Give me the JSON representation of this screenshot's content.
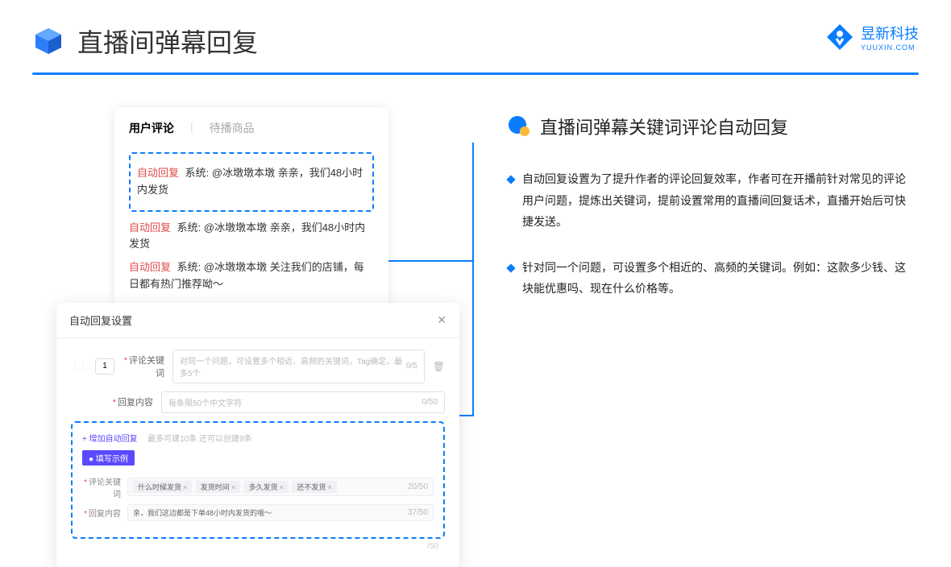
{
  "header": {
    "title": "直播间弹幕回复"
  },
  "brand": {
    "cn": "昱新科技",
    "en": "YUUXIN.COM"
  },
  "comments": {
    "tab_active": "用户评论",
    "tab_inactive": "待播商品",
    "auto_label": "自动回复",
    "sys_label": "系统:",
    "line1": "@冰墩墩本墩 亲亲，我们48小时内发货",
    "line2": "@冰墩墩本墩 亲亲，我们48小时内发货",
    "line3": "@冰墩墩本墩 关注我们的店铺，每日都有热门推荐呦～"
  },
  "modal": {
    "title": "自动回复设置",
    "num": "1",
    "keyword_label": "评论关键词",
    "keyword_placeholder": "对同一个问题，可设置多个相近、高频的关键词，Tag确定，最多5个",
    "keyword_count": "0/5",
    "content_label": "回复内容",
    "content_placeholder": "每条限50个中文字符",
    "content_count": "0/50",
    "add_link": "+ 增加自动回复",
    "add_hint": "最多可建10条 还可以创建9条",
    "example_badge": "● 填写示例",
    "ex_keyword_label": "评论关键词",
    "ex_content_label": "回复内容",
    "tag1": "什么时候发货",
    "tag2": "发货时间",
    "tag3": "多久发货",
    "tag4": "还不发货",
    "ex_kw_count": "20/50",
    "ex_content_value": "亲，我们这边都是下单48小时内发货的哦～",
    "ex_content_count": "37/50",
    "extra_count": "/50"
  },
  "right": {
    "title": "直播间弹幕关键词评论自动回复",
    "bullet1": "自动回复设置为了提升作者的评论回复效率，作者可在开播前针对常见的评论用户问题，提炼出关键词，提前设置常用的直播间回复话术，直播开始后可快捷发送。",
    "bullet2": "针对同一个问题，可设置多个相近的、高频的关键词。例如：这款多少钱、这块能优惠吗、现在什么价格等。"
  }
}
